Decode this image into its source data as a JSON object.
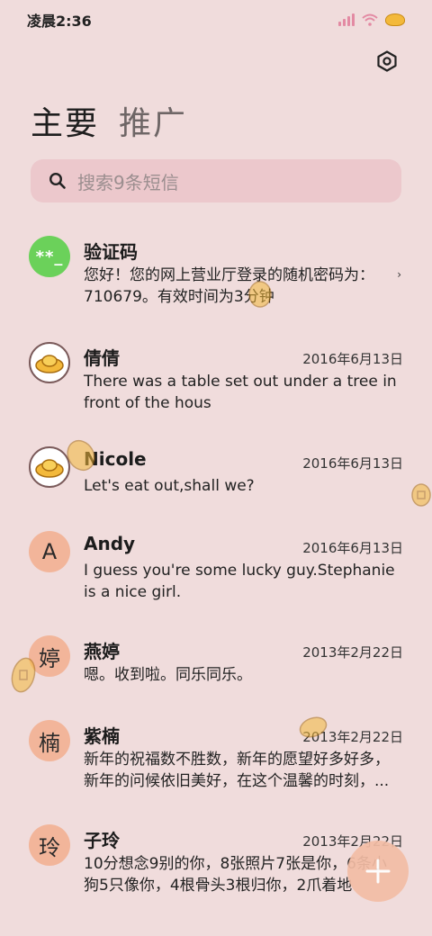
{
  "status_bar": {
    "time": "凌晨2:36"
  },
  "tabs": [
    {
      "label": "主要",
      "active": true
    },
    {
      "label": "推广",
      "active": false
    }
  ],
  "search": {
    "placeholder": "搜索9条短信"
  },
  "messages": [
    {
      "sender": "验证码",
      "avatar_text": "**_",
      "date": "",
      "preview": "您好！您的网上营业厅登录的随机密码为：710679。有效时间为3分钟"
    },
    {
      "sender": "倩倩",
      "avatar_text": "",
      "date": "2016年6月13日",
      "preview": "There was a table set out under a tree in front of the hous"
    },
    {
      "sender": "Nicole",
      "avatar_text": "",
      "date": "2016年6月13日",
      "preview": "Let's eat out,shall we?"
    },
    {
      "sender": "Andy",
      "avatar_text": "A",
      "date": "2016年6月13日",
      "preview": "I guess you're some lucky guy.Stephanie is a nice girl."
    },
    {
      "sender": "燕婷",
      "avatar_text": "婷",
      "date": "2013年2月22日",
      "preview": "嗯。收到啦。同乐同乐。"
    },
    {
      "sender": "紫楠",
      "avatar_text": "楠",
      "date": "2013年2月22日",
      "preview": "新年的祝福数不胜数，新年的愿望好多好多，新年的问候依旧美好，在这个温馨的时刻，..."
    },
    {
      "sender": "子玲",
      "avatar_text": "玲",
      "date": "2013年2月22日",
      "preview": "10分想念9别的你，8张照片7张是你，6条小狗5只像你，4根骨头3根归你，2爪着地"
    }
  ],
  "colors": {
    "background": "#f0dcdc",
    "search_bg": "#ecc8cc",
    "code_avatar": "#6bd15a",
    "letter_avatar": "#f2b59a",
    "fab": "#f3bda5"
  },
  "icons": {
    "settings": "settings-icon",
    "search": "search-icon",
    "compose": "plus-icon"
  }
}
